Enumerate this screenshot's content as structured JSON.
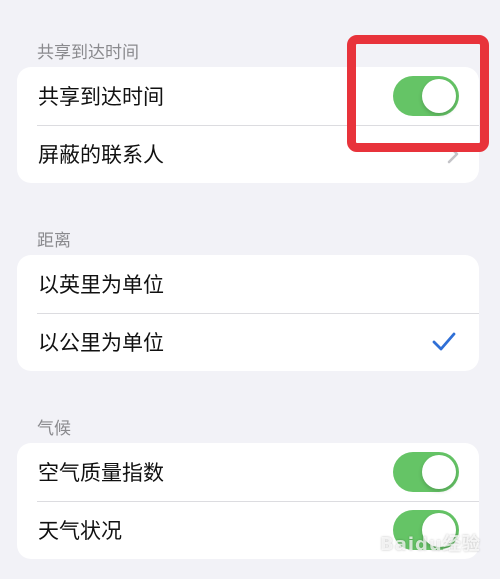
{
  "sections": [
    {
      "header": "共享到达时间",
      "rows": [
        {
          "label": "共享到达时间",
          "control": "toggle",
          "on": true
        },
        {
          "label": "屏蔽的联系人",
          "control": "chevron"
        }
      ]
    },
    {
      "header": "距离",
      "rows": [
        {
          "label": "以英里为单位",
          "control": "none"
        },
        {
          "label": "以公里为单位",
          "control": "checkmark"
        }
      ]
    },
    {
      "header": "气候",
      "rows": [
        {
          "label": "空气质量指数",
          "control": "toggle",
          "on": true
        },
        {
          "label": "天气状况",
          "control": "toggle",
          "on": true
        }
      ]
    }
  ],
  "colors": {
    "toggle_on": "#65c466",
    "checkmark": "#2f6fd6",
    "highlight_box": "#e8333b",
    "background": "#f2f2f7"
  },
  "icons": {
    "chevron": "chevron-right-icon",
    "checkmark": "checkmark-icon"
  },
  "watermark": "Baidu经验"
}
